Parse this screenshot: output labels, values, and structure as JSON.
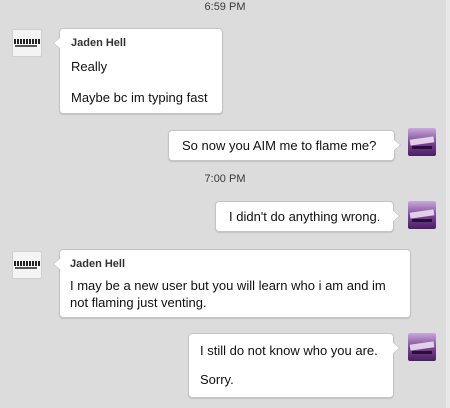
{
  "timestamps": [
    "6:59 PM",
    "7:00 PM"
  ],
  "contact": {
    "name": "Jaden Hell"
  },
  "messages": [
    {
      "from": "contact",
      "sender": "Jaden Hell",
      "lines": [
        "Really",
        "Maybe bc im typing fast"
      ]
    },
    {
      "from": "me",
      "lines": [
        "So now you AIM me to flame me?"
      ]
    },
    {
      "from": "me",
      "lines": [
        "I didn't do anything wrong."
      ]
    },
    {
      "from": "contact",
      "sender": "Jaden Hell",
      "lines": [
        "I may be a new user but you will learn who i am and im",
        "not flaming just venting."
      ]
    },
    {
      "from": "me",
      "lines": [
        "I still do not know who you are.",
        "Sorry."
      ]
    }
  ],
  "icons": {
    "contact_avatar": "contact-buddy-icon",
    "my_avatar": "my-buddy-icon"
  }
}
